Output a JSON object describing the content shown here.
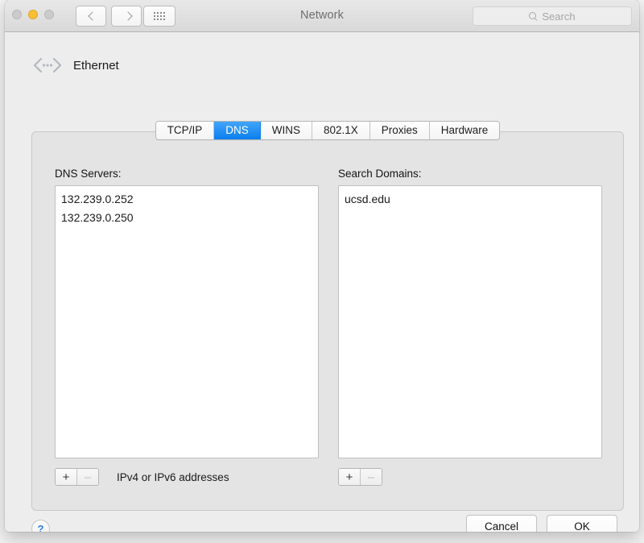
{
  "window": {
    "title": "Network",
    "traffic_lights": [
      "close",
      "minimize",
      "zoom"
    ],
    "search": {
      "placeholder": "Search",
      "value": ""
    },
    "accent_color": "#0b7ef0"
  },
  "device": {
    "name": "Ethernet",
    "icon": "ethernet-icon"
  },
  "tabs": [
    {
      "label": "TCP/IP",
      "selected": false
    },
    {
      "label": "DNS",
      "selected": true
    },
    {
      "label": "WINS",
      "selected": false
    },
    {
      "label": "802.1X",
      "selected": false
    },
    {
      "label": "Proxies",
      "selected": false
    },
    {
      "label": "Hardware",
      "selected": false
    }
  ],
  "dns_servers": {
    "label": "DNS Servers:",
    "items": [
      "132.239.0.252",
      "132.239.0.250"
    ],
    "add_label": "+",
    "remove_label": "–",
    "hint": "IPv4 or IPv6 addresses"
  },
  "search_domains": {
    "label": "Search Domains:",
    "items": [
      "ucsd.edu"
    ],
    "add_label": "+",
    "remove_label": "–"
  },
  "footer": {
    "help_label": "?",
    "cancel_label": "Cancel",
    "ok_label": "OK"
  }
}
